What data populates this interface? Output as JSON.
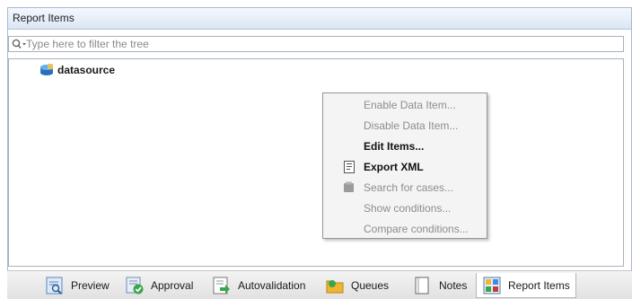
{
  "panel": {
    "title": "Report Items"
  },
  "filter": {
    "placeholder": "Type here to filter the tree",
    "value": ""
  },
  "tree": {
    "nodes": [
      {
        "label": "datasource",
        "icon": "database-icon"
      }
    ]
  },
  "context_menu": {
    "items": [
      {
        "label": "Enable Data Item...",
        "enabled": false
      },
      {
        "label": "Disable Data Item...",
        "enabled": false
      },
      {
        "label": "Edit Items...",
        "enabled": true
      },
      {
        "label": "Export XML",
        "enabled": true,
        "icon": "xml-document-icon"
      },
      {
        "label": "Search for cases...",
        "enabled": false,
        "icon": "search-cases-icon"
      },
      {
        "label": "Show conditions...",
        "enabled": false
      },
      {
        "label": "Compare conditions...",
        "enabled": false
      }
    ]
  },
  "tabs": [
    {
      "label": "Preview",
      "icon": "preview-icon"
    },
    {
      "label": "Approval",
      "icon": "approval-icon"
    },
    {
      "label": "Autovalidation",
      "icon": "autovalidation-icon"
    },
    {
      "label": "Queues",
      "icon": "queues-icon"
    },
    {
      "label": "Notes",
      "icon": "notes-icon"
    },
    {
      "label": "Report Items",
      "icon": "report-items-icon",
      "active": true
    }
  ]
}
